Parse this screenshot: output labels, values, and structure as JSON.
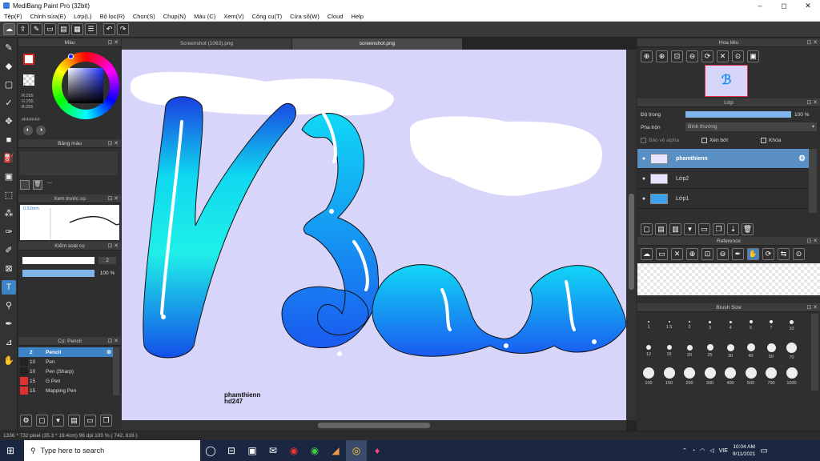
{
  "window": {
    "title": "MediBang Paint Pro (32bit)",
    "minimize": "–",
    "maximize": "◻",
    "close": "✕"
  },
  "menu": [
    "Tệp(F)",
    "Chỉnh sửa(E)",
    "Lớp(L)",
    "Bộ lọc(R)",
    "Chọn(S)",
    "Chụp(N)",
    "Màu (C)",
    "Xem(V)",
    "Công cụ(T)",
    "Cửa sổ(W)",
    "Cloud",
    "Help"
  ],
  "tabs": [
    "Screenshot (1063).png",
    "screenshot.png"
  ],
  "color_panel": {
    "title": "Màu",
    "r": "R:255",
    "g": "G:255",
    "b": "B:255",
    "hex": "#FFFFFF"
  },
  "palette_panel": {
    "title": "Bảng màu",
    "dash": "---"
  },
  "brush_preview": {
    "title": "Xem trước cọ",
    "size": "0.53mm"
  },
  "brush_control": {
    "title": "Kiểm soát cọ",
    "size_value": "2",
    "opacity_value": "100 %"
  },
  "brush_list": {
    "title": "Cọ: Pencil",
    "items": [
      {
        "num": "2",
        "name": "Pencil",
        "swatch": "#3d84c6"
      },
      {
        "num": "10",
        "name": "Pen",
        "swatch": "#222222"
      },
      {
        "num": "10",
        "name": "Pen (Sharp)",
        "swatch": "#222222"
      },
      {
        "num": "15",
        "name": "G Pen",
        "swatch": "#e03030"
      },
      {
        "num": "15",
        "name": "Mapping Pen",
        "swatch": "#e03030"
      }
    ]
  },
  "navigator": {
    "title": "Hoa tiêu"
  },
  "layer_panel": {
    "title": "Lớp",
    "opacity_label": "Độ trong",
    "opacity_value": "100 %",
    "blend_label": "Pha trộn",
    "blend_value": "Bình thường",
    "protect_alpha": "Bảo vệ alpha",
    "clipping": "Xén bớt",
    "lock": "Khóa",
    "layers": [
      {
        "name": "phamthienn"
      },
      {
        "name": "Lớp2"
      },
      {
        "name": "Lớp1"
      }
    ]
  },
  "reference_panel": {
    "title": "Reference"
  },
  "brush_size_panel": {
    "title": "Brush Size",
    "sizes": [
      "1",
      "1.5",
      "2",
      "3",
      "4",
      "5",
      "7",
      "10",
      "12",
      "15",
      "20",
      "25",
      "30",
      "40",
      "50",
      "70",
      "100",
      "150",
      "200",
      "300",
      "400",
      "500",
      "700",
      "1000"
    ]
  },
  "canvas_text": {
    "line1": "phamthienn",
    "line2": "hd247"
  },
  "status": "1336 * 732 pixel  (35.3 * 19.4cm)  96 dpi  100 %  ( 742, 616 )",
  "taskbar": {
    "search_placeholder": "Type here to search",
    "time": "10:04 AM",
    "date": "9/11/2021",
    "lang": "VIE"
  }
}
